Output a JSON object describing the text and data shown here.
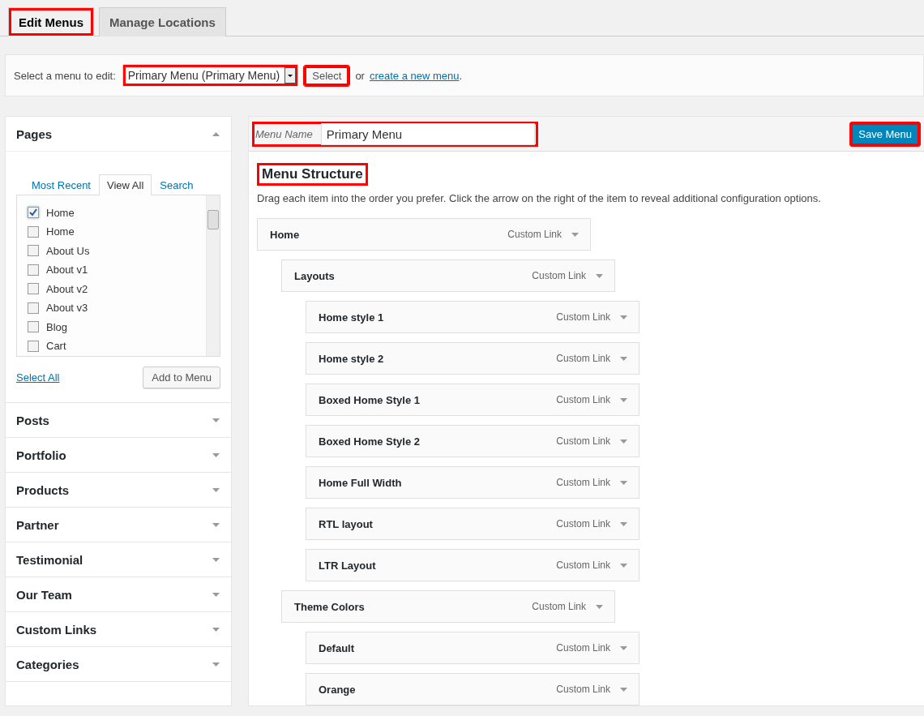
{
  "tabs": [
    {
      "label": "Edit Menus",
      "selected": true,
      "highlighted": true
    },
    {
      "label": "Manage Locations",
      "selected": false,
      "highlighted": false
    }
  ],
  "menu_select": {
    "label": "Select a menu to edit:",
    "value": "Primary Menu (Primary Menu)",
    "highlighted": true,
    "button": {
      "label": "Select",
      "highlighted": true
    },
    "or_text": "or",
    "link": "create a new menu",
    "after_link": "."
  },
  "sidebar": {
    "sections": [
      {
        "title": "Pages",
        "expanded": true,
        "tabs": [
          {
            "label": "Most Recent",
            "selected": false
          },
          {
            "label": "View All",
            "selected": true
          },
          {
            "label": "Search",
            "selected": false
          }
        ],
        "items": [
          {
            "label": "Home",
            "checked": true
          },
          {
            "label": "Home",
            "checked": false
          },
          {
            "label": "About Us",
            "checked": false
          },
          {
            "label": "About v1",
            "checked": false
          },
          {
            "label": "About v2",
            "checked": false
          },
          {
            "label": "About v3",
            "checked": false
          },
          {
            "label": "Blog",
            "checked": false
          },
          {
            "label": "Cart",
            "checked": false
          }
        ],
        "select_all": "Select All",
        "add_button": "Add to Menu"
      },
      {
        "title": "Posts",
        "expanded": false
      },
      {
        "title": "Portfolio",
        "expanded": false
      },
      {
        "title": "Products",
        "expanded": false
      },
      {
        "title": "Partner",
        "expanded": false
      },
      {
        "title": "Testimonial",
        "expanded": false
      },
      {
        "title": "Our Team",
        "expanded": false
      },
      {
        "title": "Custom Links",
        "expanded": false
      },
      {
        "title": "Categories",
        "expanded": false
      }
    ]
  },
  "menu_name": {
    "label": "Menu Name",
    "value": "Primary Menu",
    "highlighted": true
  },
  "save_button": {
    "label": "Save Menu",
    "highlighted": true
  },
  "structure": {
    "title": "Menu Structure",
    "highlighted": true,
    "hint": "Drag each item into the order you prefer. Click the arrow on the right of the item to reveal additional configuration options.",
    "items": [
      {
        "title": "Home",
        "type": "Custom Link",
        "children": [
          {
            "title": "Layouts",
            "type": "Custom Link",
            "children": [
              {
                "title": "Home style 1",
                "type": "Custom Link"
              },
              {
                "title": "Home style 2",
                "type": "Custom Link"
              },
              {
                "title": "Boxed Home Style 1",
                "type": "Custom Link"
              },
              {
                "title": "Boxed Home Style 2",
                "type": "Custom Link"
              },
              {
                "title": "Home Full Width",
                "type": "Custom Link"
              },
              {
                "title": "RTL layout",
                "type": "Custom Link"
              },
              {
                "title": "LTR Layout",
                "type": "Custom Link"
              }
            ]
          },
          {
            "title": "Theme Colors",
            "type": "Custom Link",
            "children": [
              {
                "title": "Default",
                "type": "Custom Link"
              },
              {
                "title": "Orange",
                "type": "Custom Link"
              }
            ]
          }
        ]
      }
    ]
  }
}
